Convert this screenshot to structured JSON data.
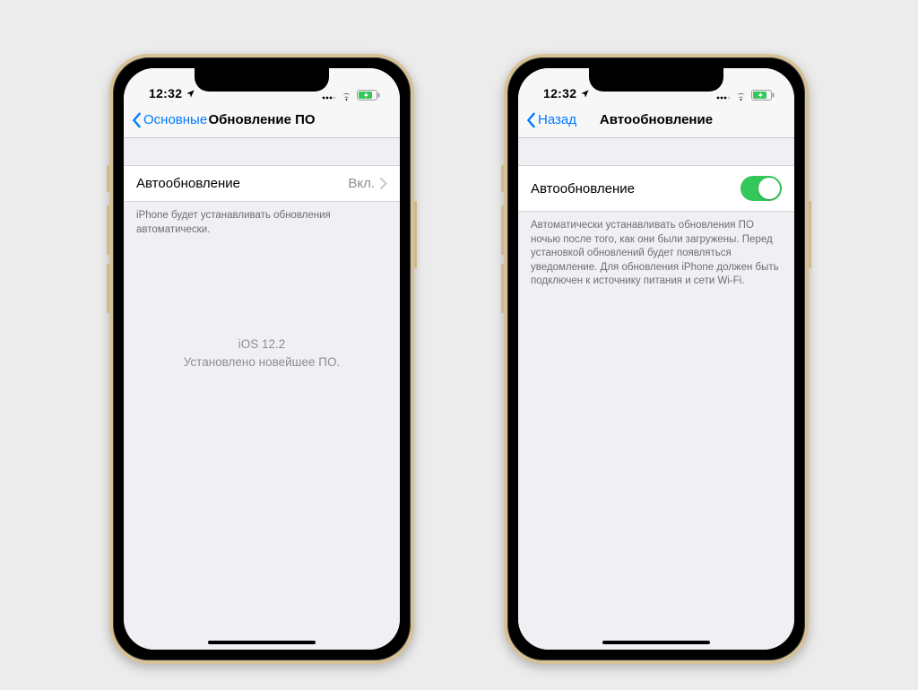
{
  "status": {
    "time": "12:32",
    "location_icon": "location-arrow",
    "signal_icon": "signal-dots",
    "wifi_icon": "wifi",
    "battery_icon": "battery-charging"
  },
  "left_phone": {
    "back_label": "Основные",
    "title": "Обновление ПО",
    "cell": {
      "label": "Автообновление",
      "value": "Вкл."
    },
    "footer": "iPhone будет устанавливать обновления автоматически.",
    "center_line1": "iOS 12.2",
    "center_line2": "Установлено новейшее ПО."
  },
  "right_phone": {
    "back_label": "Назад",
    "title": "Автообновление",
    "cell": {
      "label": "Автообновление",
      "toggle_on": true
    },
    "footer": "Автоматически устанавливать обновления ПО ночью после того, как они были загружены. Перед установкой обновлений будет появляться уведомление. Для обновления iPhone должен быть подключен к источнику питания и сети Wi-Fi."
  }
}
